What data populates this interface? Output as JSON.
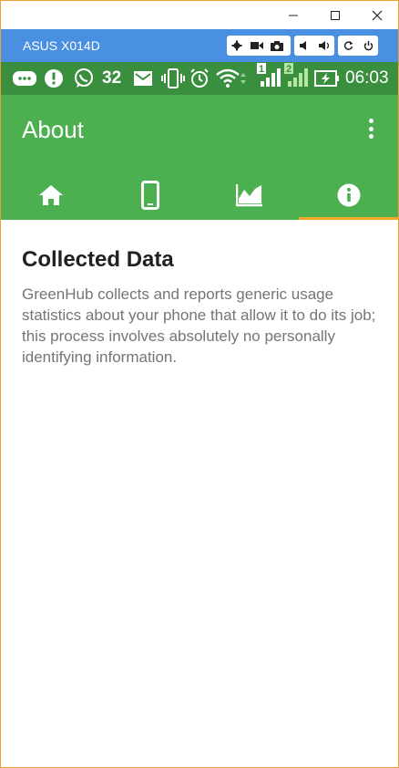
{
  "window": {
    "device_name": "ASUS X014D"
  },
  "status_bar": {
    "notification_count": "32",
    "sim1_label": "1",
    "sim2_label": "2",
    "time": "06:03"
  },
  "appbar": {
    "title": "About"
  },
  "tabs": [
    {
      "icon": "home-icon"
    },
    {
      "icon": "phone-icon"
    },
    {
      "icon": "chart-icon"
    },
    {
      "icon": "info-icon"
    }
  ],
  "selected_tab": 3,
  "colors": {
    "window_border": "#f0a030",
    "emulator_bar": "#4a90e2",
    "status_bar": "#3a8f3e",
    "primary": "#4caf50",
    "tab_indicator": "#f5a623",
    "heading": "#212121",
    "body_text": "#757575"
  },
  "content": {
    "heading": "Collected Data",
    "body": "GreenHub collects and reports generic usage statistics about your phone that allow it to do its job; this process involves absolutely no personally identifying information."
  }
}
